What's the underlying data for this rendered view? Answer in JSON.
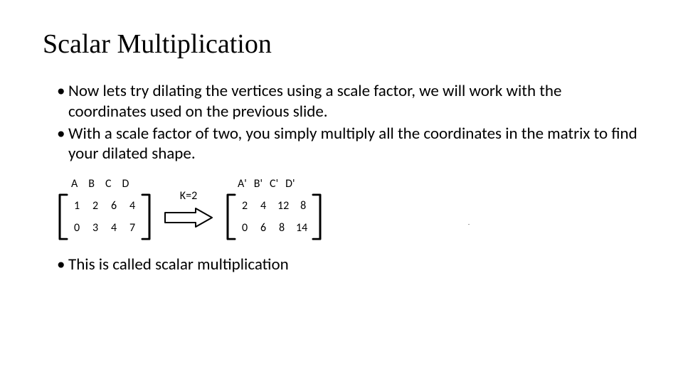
{
  "title": "Scalar Multiplication",
  "bullets": {
    "b1": "Now lets try dilating the vertices using a scale factor, we will work with the coordinates used on the previous slide.",
    "b2": "With a scale factor of two, you simply multiply all the coordinates in the matrix to find your dilated shape.",
    "b3": "This is called scalar multiplication"
  },
  "diagram": {
    "k_label": "K=2",
    "matrix_in": {
      "cols": {
        "c0": "A",
        "c1": "B",
        "c2": "C",
        "c3": "D"
      },
      "row0": {
        "v0": "1",
        "v1": "2",
        "v2": "6",
        "v3": "4"
      },
      "row1": {
        "v0": "0",
        "v1": "3",
        "v2": "4",
        "v3": "7"
      }
    },
    "matrix_out": {
      "cols": {
        "c0": "A'",
        "c1": "B'",
        "c2": "C'",
        "c3": "D'"
      },
      "row0": {
        "v0": "2",
        "v1": "4",
        "v2": "12",
        "v3": "8"
      },
      "row1": {
        "v0": "0",
        "v1": "6",
        "v2": "8",
        "v3": "14"
      }
    }
  },
  "chart_data": {
    "type": "table",
    "title": "Scalar multiplication of vertex coordinate matrix by K=2",
    "scalar": 2,
    "input_matrix": {
      "columns": [
        "A",
        "B",
        "C",
        "D"
      ],
      "rows": [
        [
          1,
          2,
          6,
          4
        ],
        [
          0,
          3,
          4,
          7
        ]
      ]
    },
    "output_matrix": {
      "columns": [
        "A'",
        "B'",
        "C'",
        "D'"
      ],
      "rows": [
        [
          2,
          4,
          12,
          8
        ],
        [
          0,
          6,
          8,
          14
        ]
      ]
    }
  }
}
